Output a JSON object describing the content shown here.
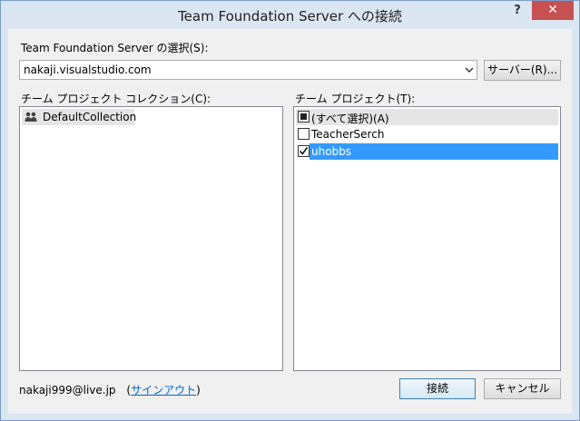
{
  "window": {
    "title": "Team Foundation Server への接続",
    "help_label": "?",
    "close_label": "✕"
  },
  "server": {
    "label": "Team Foundation Server の選択(S):",
    "value": "nakaji.visualstudio.com",
    "servers_button": "サーバー(R)..."
  },
  "collections": {
    "label": "チーム プロジェクト コレクション(C):",
    "items": [
      {
        "label": "DefaultCollection",
        "icon": "collection-icon"
      }
    ]
  },
  "projects": {
    "label": "チーム プロジェクト(T):",
    "items": [
      {
        "label": "(すべて選択)(A)",
        "state": "indeterminate"
      },
      {
        "label": "TeacherSerch",
        "state": "unchecked"
      },
      {
        "label": "uhobbs",
        "state": "checked"
      }
    ]
  },
  "footer": {
    "account": "nakaji999@live.jp",
    "paren_open": "(",
    "signout_link": "サインアウト",
    "paren_close": ")",
    "connect_button": "接続",
    "cancel_button": "キャンセル"
  }
}
